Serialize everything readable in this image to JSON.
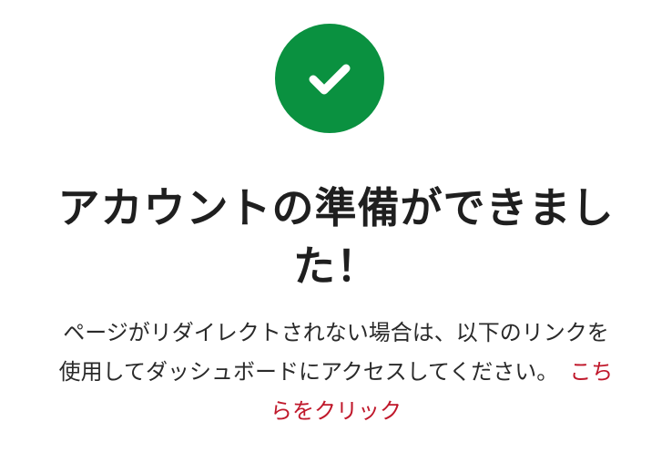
{
  "status": {
    "icon": "check-circle-icon",
    "icon_color": "#0a9140",
    "check_color": "#ffffff"
  },
  "heading": {
    "title": "アカウントの準備ができました！"
  },
  "message": {
    "text": "ページがリダイレクトされない場合は、以下のリンクを使用してダッシュボードにアクセスしてください。",
    "link_label": "こちらをクリック",
    "link_color": "#c0182b"
  }
}
